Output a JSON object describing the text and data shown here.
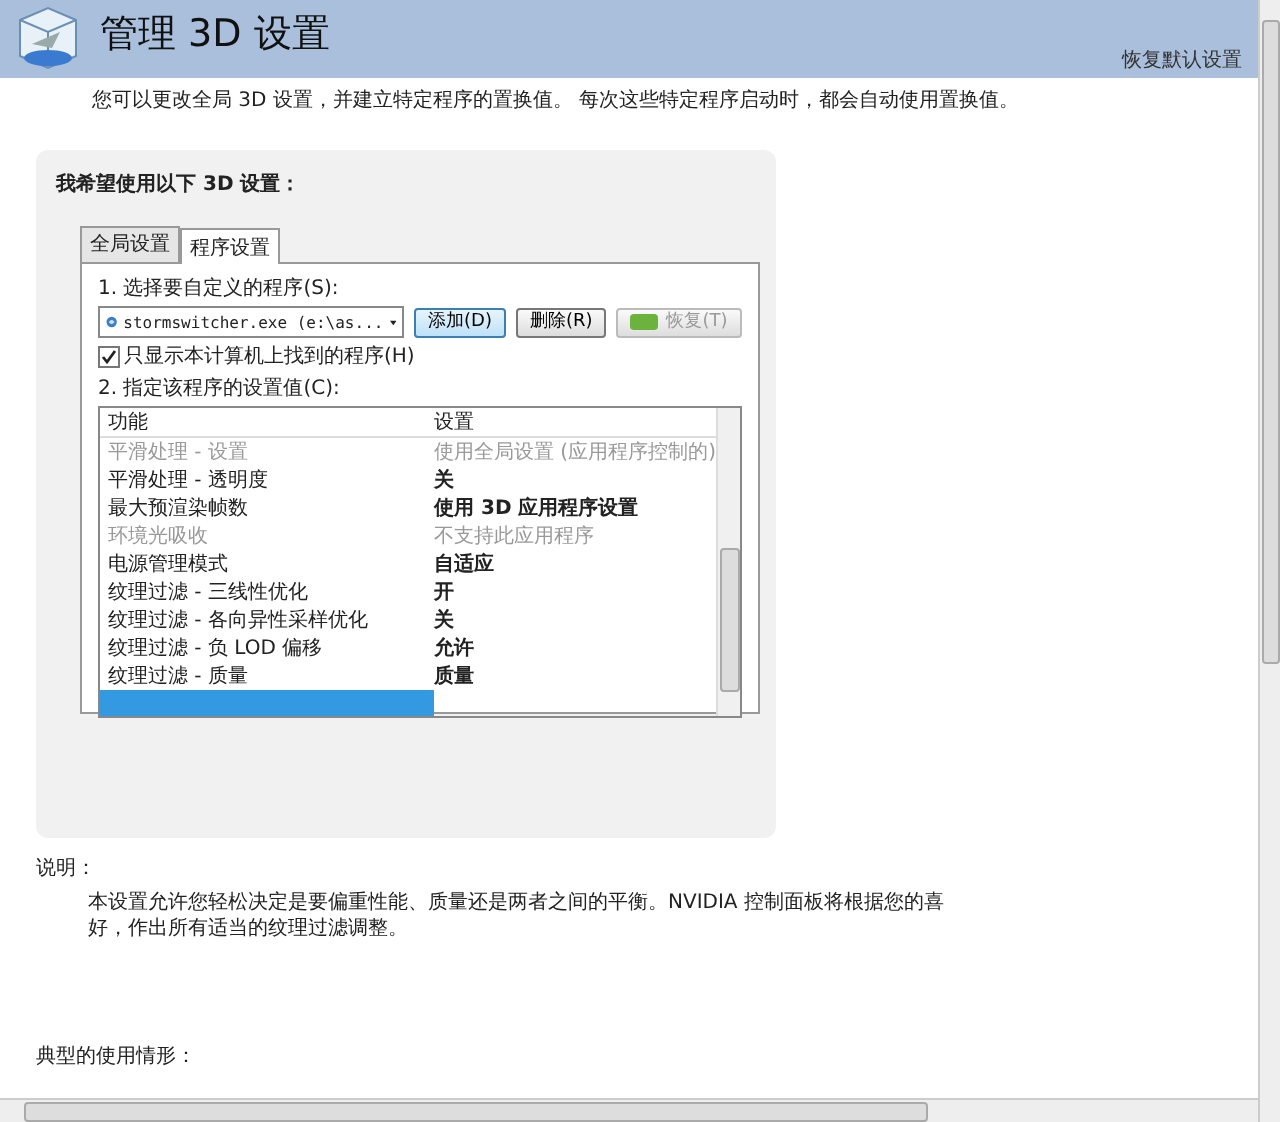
{
  "header": {
    "title": "管理 3D 设置",
    "restore_link": "恢复默认设置"
  },
  "intro": "您可以更改全局 3D 设置，并建立特定程序的置换值。 每次这些特定程序启动时，都会自动使用置换值。",
  "settings_heading": "我希望使用以下 3D 设置：",
  "tabs": [
    {
      "label": "全局设置",
      "selected": false
    },
    {
      "label": "程序设置",
      "selected": true
    }
  ],
  "step1_label": "1. 选择要自定义的程序(S):",
  "program_select": {
    "value": "stormswitcher.exe (e:\\as..."
  },
  "buttons": [
    {
      "label": "添加(D)",
      "disabled": false,
      "kind": "primary"
    },
    {
      "label": "删除(R)",
      "disabled": false,
      "kind": "plain"
    },
    {
      "label": "恢复(T)",
      "disabled": true,
      "kind": "icon"
    }
  ],
  "only_local_checkbox": {
    "label": "只显示本计算机上找到的程序(H)",
    "checked": true
  },
  "step2_label": "2. 指定该程序的设置值(C):",
  "table": {
    "columns": [
      "功能",
      "设置"
    ],
    "rows": [
      {
        "feature": "平滑处理 - 设置",
        "value": "使用全局设置 (应用程序控制的)",
        "disabled": true,
        "selected": false
      },
      {
        "feature": "平滑处理 - 透明度",
        "value": "关",
        "disabled": false,
        "selected": false
      },
      {
        "feature": "最大预渲染帧数",
        "value": "使用 3D 应用程序设置",
        "disabled": false,
        "selected": false
      },
      {
        "feature": "环境光吸收",
        "value": "不支持此应用程序",
        "disabled": true,
        "selected": false
      },
      {
        "feature": "电源管理模式",
        "value": "自适应",
        "disabled": false,
        "selected": false
      },
      {
        "feature": "纹理过滤 - 三线性优化",
        "value": "开",
        "disabled": false,
        "selected": false
      },
      {
        "feature": "纹理过滤 - 各向异性采样优化",
        "value": "关",
        "disabled": false,
        "selected": false
      },
      {
        "feature": "纹理过滤 - 负 LOD 偏移",
        "value": "允许",
        "disabled": false,
        "selected": false
      },
      {
        "feature": "纹理过滤 - 质量",
        "value": "质量",
        "disabled": false,
        "selected": false
      },
      {
        "feature": "",
        "value": "",
        "disabled": false,
        "selected": true
      }
    ]
  },
  "description": {
    "heading": "说明：",
    "text": "本设置允许您轻松决定是要偏重性能、质量还是两者之间的平衡。NVIDIA 控制面板将根据您的喜好，作出所有适当的纹理过滤调整。"
  },
  "usage": {
    "heading": "典型的使用情形："
  }
}
